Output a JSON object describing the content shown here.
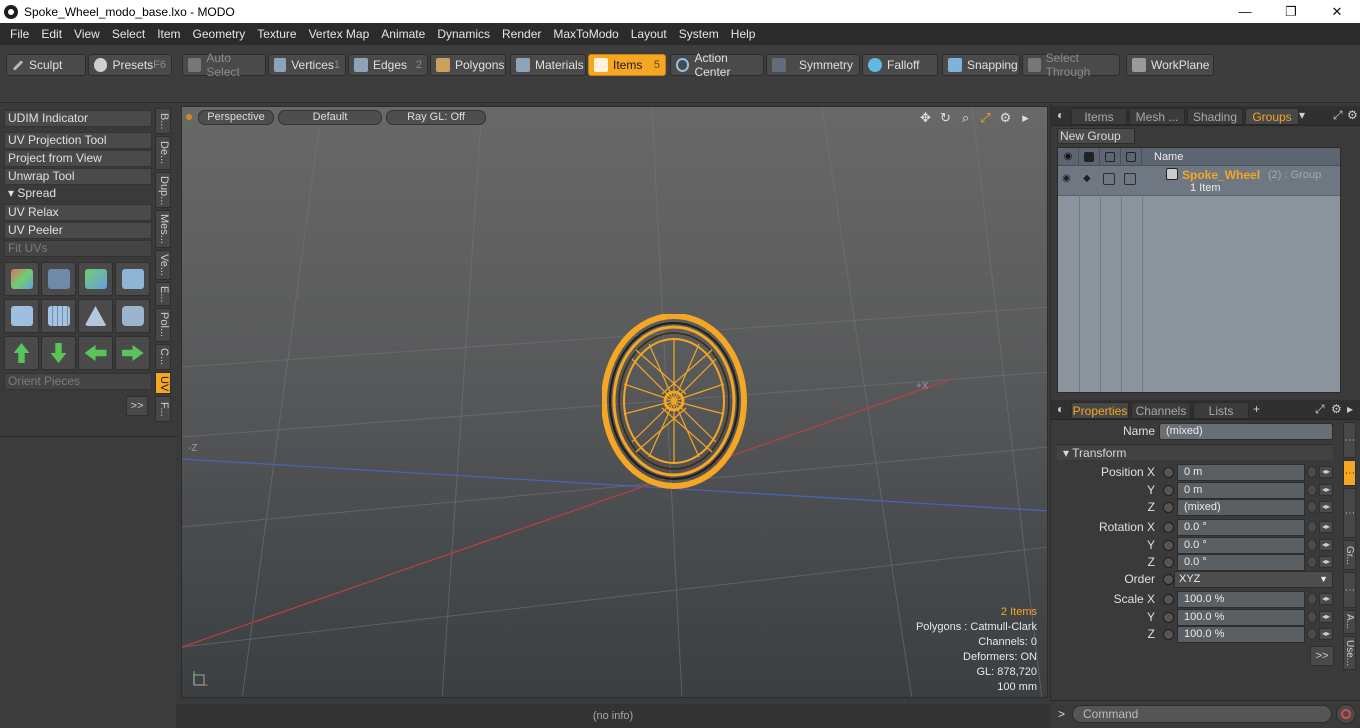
{
  "window": {
    "title": "Spoke_Wheel_modo_base.lxo - MODO",
    "min_glyph": "—",
    "max_glyph": "❐",
    "close_glyph": "✕"
  },
  "menu": [
    "File",
    "Edit",
    "View",
    "Select",
    "Item",
    "Geometry",
    "Texture",
    "Vertex Map",
    "Animate",
    "Dynamics",
    "Render",
    "MaxToModo",
    "Layout",
    "System",
    "Help"
  ],
  "toolbar": {
    "sculpt": "Sculpt",
    "presets": "Presets",
    "presets_key": "F6",
    "auto_select": "Auto Select",
    "vertices": "Vertices",
    "vertices_num": "1",
    "edges": "Edges",
    "edges_num": "2",
    "polygons": "Polygons",
    "materials": "Materials",
    "items": "Items",
    "items_num": "5",
    "action_center": "Action Center",
    "symmetry": "Symmetry",
    "falloff": "Falloff",
    "snapping": "Snapping",
    "select_through": "Select Through",
    "workplane": "WorkPlane"
  },
  "left_panel": {
    "udim": "UDIM Indicator",
    "uv_projection": "UV Projection Tool",
    "project_from_view": "Project from View",
    "unwrap": "Unwrap Tool",
    "spread": "Spread",
    "uv_relax": "UV Relax",
    "uv_peeler": "UV Peeler",
    "fit_uvs": "Fit UVs",
    "orient_pieces": "Orient Pieces",
    "more": ">>",
    "vtabs": [
      "B...",
      "De...",
      "Dup...",
      "Mes...",
      "Ve...",
      "E...",
      "Pol...",
      "C...",
      "UV",
      "F..."
    ]
  },
  "viewport": {
    "perspective": "Perspective",
    "default": "Default",
    "raygl": "Ray GL: Off",
    "axis_x": "+X",
    "axis_z": "-Z",
    "stats": {
      "items": "2 Items",
      "polygons": "Polygons : Catmull-Clark",
      "channels": "Channels: 0",
      "deformers": "Deformers: ON",
      "gl": "GL: 878,720",
      "unit": "100 mm"
    }
  },
  "status_bar": "(no info)",
  "right_panel": {
    "tabs": [
      "Items",
      "Mesh ...",
      "Shading",
      "Groups"
    ],
    "new_group": "New Group",
    "name_header": "Name",
    "group": {
      "name": "Spoke_Wheel",
      "suffix": "(2) : Group",
      "sub": "1 Item"
    },
    "prop_tabs": [
      "Properties",
      "Channels",
      "Lists"
    ],
    "add_tab": "+",
    "props": {
      "name_label": "Name",
      "name_value": "(mixed)",
      "transform": "Transform",
      "position_x_label": "Position X",
      "position_x": "0 m",
      "position_y_label": "Y",
      "position_y": "0 m",
      "position_z_label": "Z",
      "position_z": "(mixed)",
      "rotation_x_label": "Rotation X",
      "rotation_x": "0.0 °",
      "rotation_y_label": "Y",
      "rotation_y": "0.0 °",
      "rotation_z_label": "Z",
      "rotation_z": "0.0 °",
      "order_label": "Order",
      "order_value": "XYZ",
      "scale_x_label": "Scale X",
      "scale_x": "100.0 %",
      "scale_y_label": "Y",
      "scale_y": "100.0 %",
      "scale_z_label": "Z",
      "scale_z": "100.0 %"
    },
    "more": ">>",
    "side_tabs": [
      "Gr...",
      "A...",
      "Use..."
    ]
  },
  "command": {
    "prompt": ">",
    "placeholder": "Command"
  },
  "colors": {
    "accent": "#f5a623",
    "wire": "#f5a623"
  }
}
